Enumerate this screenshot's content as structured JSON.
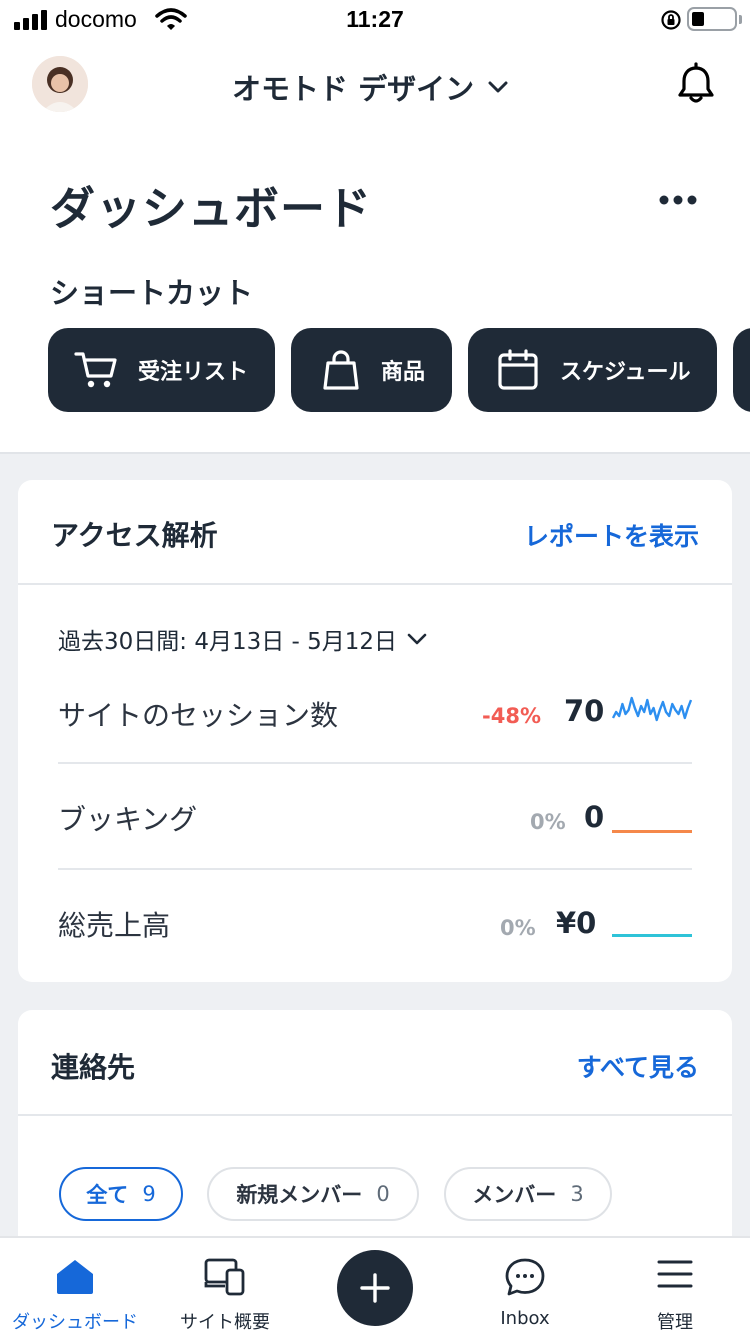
{
  "status_bar": {
    "carrier": "docomo",
    "time": "11:27"
  },
  "header": {
    "workspace": "オモトド デザイン",
    "title": "ダッシュボード"
  },
  "shortcuts": {
    "title": "ショートカット",
    "items": [
      {
        "label": "受注リスト",
        "icon": "cart-icon"
      },
      {
        "label": "商品",
        "icon": "shopping-bag-icon"
      },
      {
        "label": "スケジュール",
        "icon": "calendar-icon"
      }
    ]
  },
  "analytics": {
    "title": "アクセス解析",
    "link": "レポートを表示",
    "date_range": "過去30日間: 4月13日 - 5月12日",
    "metrics": [
      {
        "label": "サイトのセッション数",
        "change": "-48%",
        "value": "70",
        "spark_color": "#2d8ff0",
        "change_color": "#f25c54"
      },
      {
        "label": "ブッキング",
        "change": "0%",
        "value": "0",
        "spark_color": "#f5884a",
        "change_color": "#a3a9b0"
      },
      {
        "label": "総売上高",
        "change": "0%",
        "value": "¥0",
        "spark_color": "#2ec3d8",
        "change_color": "#a3a9b0"
      }
    ]
  },
  "contacts": {
    "title": "連絡先",
    "link": "すべて見る",
    "filters": [
      {
        "label": "全て",
        "count": "9"
      },
      {
        "label": "新規メンバー",
        "count": "0"
      },
      {
        "label": "メンバー",
        "count": "3"
      }
    ]
  },
  "bottom_nav": {
    "items": [
      {
        "label": "ダッシュボード",
        "icon": "home-icon"
      },
      {
        "label": "サイト概要",
        "icon": "devices-icon"
      },
      {
        "label": "",
        "icon": "plus-icon"
      },
      {
        "label": "Inbox",
        "icon": "chat-bubble-icon"
      },
      {
        "label": "管理",
        "icon": "menu-icon"
      }
    ]
  },
  "colors": {
    "primary_dark": "#1f2a37",
    "accent_blue": "#1668d9",
    "background": "#eef0f3"
  }
}
